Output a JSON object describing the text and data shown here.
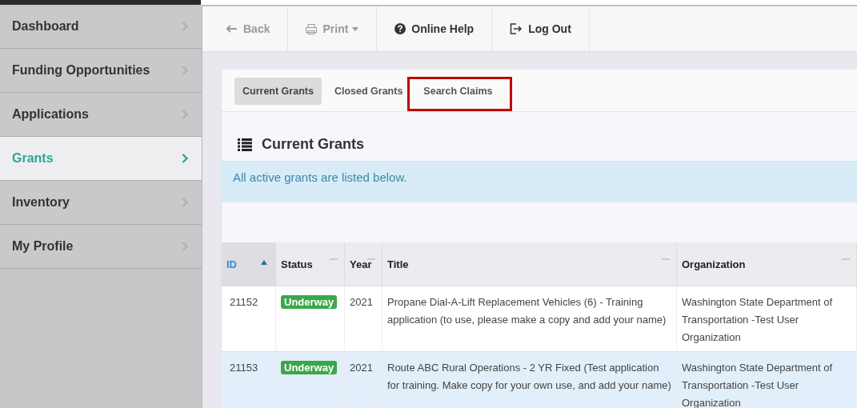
{
  "sidebar": {
    "items": [
      {
        "label": "Dashboard",
        "selected": false
      },
      {
        "label": "Funding Opportunities",
        "selected": false
      },
      {
        "label": "Applications",
        "selected": false
      },
      {
        "label": "Grants",
        "selected": true
      },
      {
        "label": "Inventory",
        "selected": false
      },
      {
        "label": "My Profile",
        "selected": false
      }
    ]
  },
  "toolbar": {
    "buttons": [
      {
        "label": "Back",
        "kind": "back",
        "disabled": true
      },
      {
        "label": "Print",
        "kind": "print",
        "disabled": true
      },
      {
        "label": "Online Help",
        "kind": "help",
        "disabled": false
      },
      {
        "label": "Log Out",
        "kind": "logout",
        "disabled": false
      }
    ]
  },
  "tabs": [
    {
      "label": "Current Grants",
      "selected": true
    },
    {
      "label": "Closed Grants",
      "selected": false
    },
    {
      "label": "Search Claims",
      "selected": false,
      "annotated": true
    }
  ],
  "heading": "Current Grants",
  "alert": "All active grants are listed below.",
  "table": {
    "columns": [
      {
        "label": "ID",
        "sorted": true
      },
      {
        "label": "Status",
        "sorted": false
      },
      {
        "label": "Year",
        "sorted": false
      },
      {
        "label": "Title",
        "sorted": false
      },
      {
        "label": "Organization",
        "sorted": false
      }
    ],
    "rows": [
      {
        "id": "21152",
        "status": "Underway",
        "year": "2021",
        "title": "Propane Dial-A-Lift Replacement Vehicles (6) - Training application (to use, please make a copy and add your name)",
        "organization": "Washington State Department of Transportation -Test User Organization",
        "selected": false
      },
      {
        "id": "21153",
        "status": "Underway",
        "year": "2021",
        "title": "Route ABC Rural Operations - 2 YR Fixed (Test application for training. Make copy for your own use, and add your name)",
        "organization": "Washington State Department of Transportation -Test User Organization",
        "selected": true
      }
    ]
  }
}
